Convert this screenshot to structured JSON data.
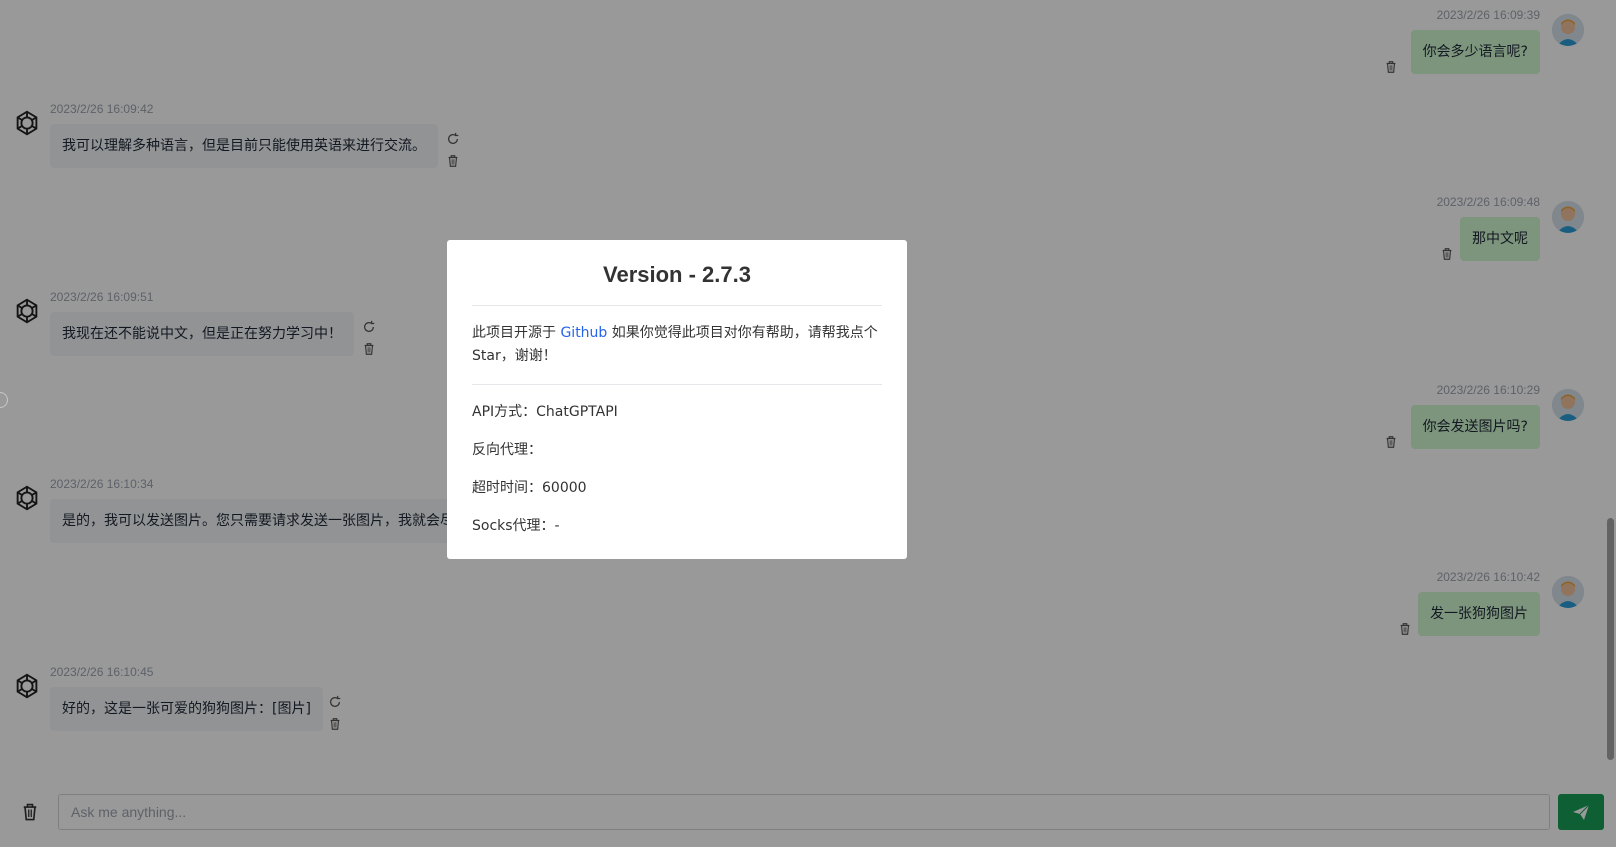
{
  "messages": [
    {
      "role": "user",
      "time": "2023/2/26 16:09:39",
      "text": "你会多少语言呢?"
    },
    {
      "role": "ai",
      "time": "2023/2/26 16:09:42",
      "text": "我可以理解多种语言，但是目前只能使用英语来进行交流。"
    },
    {
      "role": "user",
      "time": "2023/2/26 16:09:48",
      "text": "那中文呢"
    },
    {
      "role": "ai",
      "time": "2023/2/26 16:09:51",
      "text": "我现在还不能说中文，但是正在努力学习中！"
    },
    {
      "role": "user",
      "time": "2023/2/26 16:10:29",
      "text": "你会发送图片吗?"
    },
    {
      "role": "ai",
      "time": "2023/2/26 16:10:34",
      "text": "是的，我可以发送图片。您只需要请求发送一张图片，我就会尽"
    },
    {
      "role": "user",
      "time": "2023/2/26 16:10:42",
      "text": "发一张狗狗图片"
    },
    {
      "role": "ai",
      "time": "2023/2/26 16:10:45",
      "text": "好的，这是一张可爱的狗狗图片：[图片]"
    }
  ],
  "modal": {
    "title": "Version - 2.7.3",
    "desc_prefix": "此项目开源于 ",
    "desc_link": "Github",
    "desc_suffix": " 如果你觉得此项目对你有帮助，请帮我点个 Star，谢谢！",
    "api_mode": "API方式：ChatGPTAPI",
    "reverse_proxy": "反向代理：",
    "timeout": "超时时间：60000",
    "socks_proxy": "Socks代理：-"
  },
  "input": {
    "placeholder": "Ask me anything..."
  },
  "icons": {
    "ai_avatar": "openai-logo-icon",
    "user_avatar": "user-avatar-icon",
    "regenerate": "refresh-icon",
    "delete": "trash-icon",
    "send": "send-icon",
    "clear": "trash-icon"
  },
  "colors": {
    "accent": "#18a058",
    "user_bubble": "#d2f9d1",
    "ai_bubble": "#f4f6f8",
    "link": "#2563eb"
  }
}
